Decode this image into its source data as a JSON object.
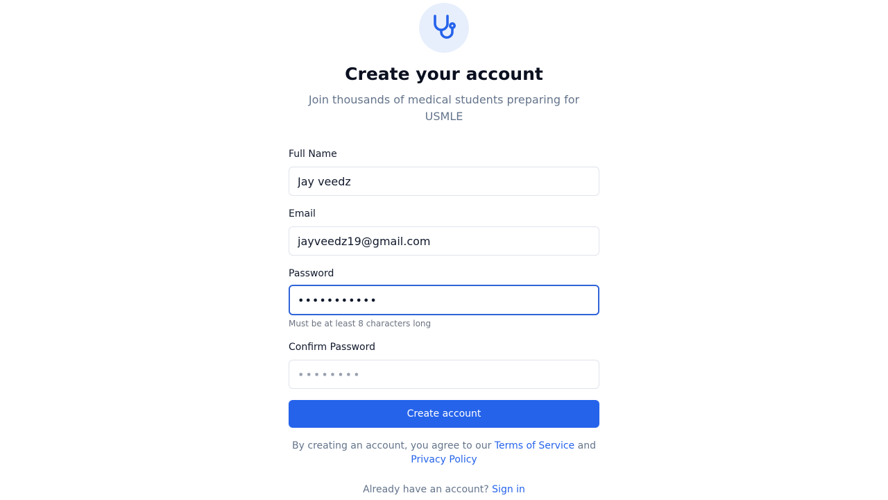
{
  "header": {
    "logo_icon": "stethoscope-icon",
    "title": "Create your account",
    "subtitle": "Join thousands of medical students preparing for USMLE"
  },
  "form": {
    "full_name": {
      "label": "Full Name",
      "value": "Jay veedz"
    },
    "email": {
      "label": "Email",
      "value": "jayveedz19@gmail.com"
    },
    "password": {
      "label": "Password",
      "value": "jayveedz19!",
      "hint": "Must be at least 8 characters long"
    },
    "confirm_password": {
      "label": "Confirm Password",
      "value": "",
      "placeholder": "••••••••"
    },
    "submit_label": "Create account"
  },
  "legal": {
    "prefix": "By creating an account, you agree to our ",
    "terms_link": "Terms of Service",
    "middle": " and ",
    "privacy_link": "Privacy Policy"
  },
  "footer": {
    "prompt": "Already have an account? ",
    "signin_link": "Sign in"
  },
  "colors": {
    "accent": "#2563eb",
    "logo_bg": "#e8effc",
    "muted_text": "#64748b"
  }
}
